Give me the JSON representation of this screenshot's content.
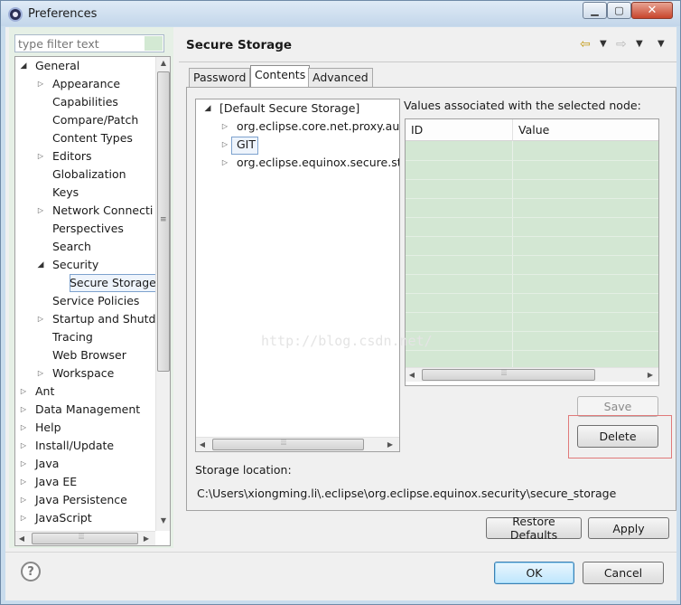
{
  "window": {
    "title": "Preferences"
  },
  "filter": {
    "placeholder": "type filter text"
  },
  "tree": [
    {
      "label": "General",
      "indent": 0,
      "twisty": "open"
    },
    {
      "label": "Appearance",
      "indent": 1,
      "twisty": "closed"
    },
    {
      "label": "Capabilities",
      "indent": 1,
      "twisty": "none"
    },
    {
      "label": "Compare/Patch",
      "indent": 1,
      "twisty": "none"
    },
    {
      "label": "Content Types",
      "indent": 1,
      "twisty": "none"
    },
    {
      "label": "Editors",
      "indent": 1,
      "twisty": "closed"
    },
    {
      "label": "Globalization",
      "indent": 1,
      "twisty": "none"
    },
    {
      "label": "Keys",
      "indent": 1,
      "twisty": "none"
    },
    {
      "label": "Network Connecti",
      "indent": 1,
      "twisty": "closed"
    },
    {
      "label": "Perspectives",
      "indent": 1,
      "twisty": "none"
    },
    {
      "label": "Search",
      "indent": 1,
      "twisty": "none"
    },
    {
      "label": "Security",
      "indent": 1,
      "twisty": "open"
    },
    {
      "label": "Secure Storage",
      "indent": 2,
      "twisty": "none",
      "selected": true
    },
    {
      "label": "Service Policies",
      "indent": 1,
      "twisty": "none"
    },
    {
      "label": "Startup and Shutd",
      "indent": 1,
      "twisty": "closed"
    },
    {
      "label": "Tracing",
      "indent": 1,
      "twisty": "none"
    },
    {
      "label": "Web Browser",
      "indent": 1,
      "twisty": "none"
    },
    {
      "label": "Workspace",
      "indent": 1,
      "twisty": "closed"
    },
    {
      "label": "Ant",
      "indent": 0,
      "twisty": "closed"
    },
    {
      "label": "Data Management",
      "indent": 0,
      "twisty": "closed"
    },
    {
      "label": "Help",
      "indent": 0,
      "twisty": "closed"
    },
    {
      "label": "Install/Update",
      "indent": 0,
      "twisty": "closed"
    },
    {
      "label": "Java",
      "indent": 0,
      "twisty": "closed"
    },
    {
      "label": "Java EE",
      "indent": 0,
      "twisty": "closed"
    },
    {
      "label": "Java Persistence",
      "indent": 0,
      "twisty": "closed"
    },
    {
      "label": "JavaScript",
      "indent": 0,
      "twisty": "closed"
    }
  ],
  "page": {
    "title": "Secure Storage"
  },
  "tabs": [
    {
      "label": "Password",
      "active": false
    },
    {
      "label": "Contents",
      "active": true
    },
    {
      "label": "Advanced",
      "active": false
    }
  ],
  "nodes": [
    {
      "label": "[Default Secure Storage]",
      "indent": 0,
      "twisty": "open"
    },
    {
      "label": "org.eclipse.core.net.proxy.auth",
      "indent": 1,
      "twisty": "closed"
    },
    {
      "label": "GIT",
      "indent": 1,
      "twisty": "closed",
      "selected": true
    },
    {
      "label": "org.eclipse.equinox.secure.stor",
      "indent": 1,
      "twisty": "closed"
    }
  ],
  "values": {
    "label": "Values associated with the selected node:",
    "columns": [
      "ID",
      "Value"
    ]
  },
  "buttons": {
    "save": "Save",
    "delete": "Delete",
    "restore": "Restore Defaults",
    "apply": "Apply",
    "ok": "OK",
    "cancel": "Cancel"
  },
  "storage": {
    "label": "Storage location:",
    "path": "C:\\Users\\xiongming.li\\.eclipse\\org.eclipse.equinox.security\\secure_storage"
  },
  "watermark": "http://blog.csdn.net/",
  "icons": {
    "nav_back": "back-arrow-icon",
    "nav_forward": "forward-arrow-icon",
    "view_menu": "view-menu-icon"
  }
}
